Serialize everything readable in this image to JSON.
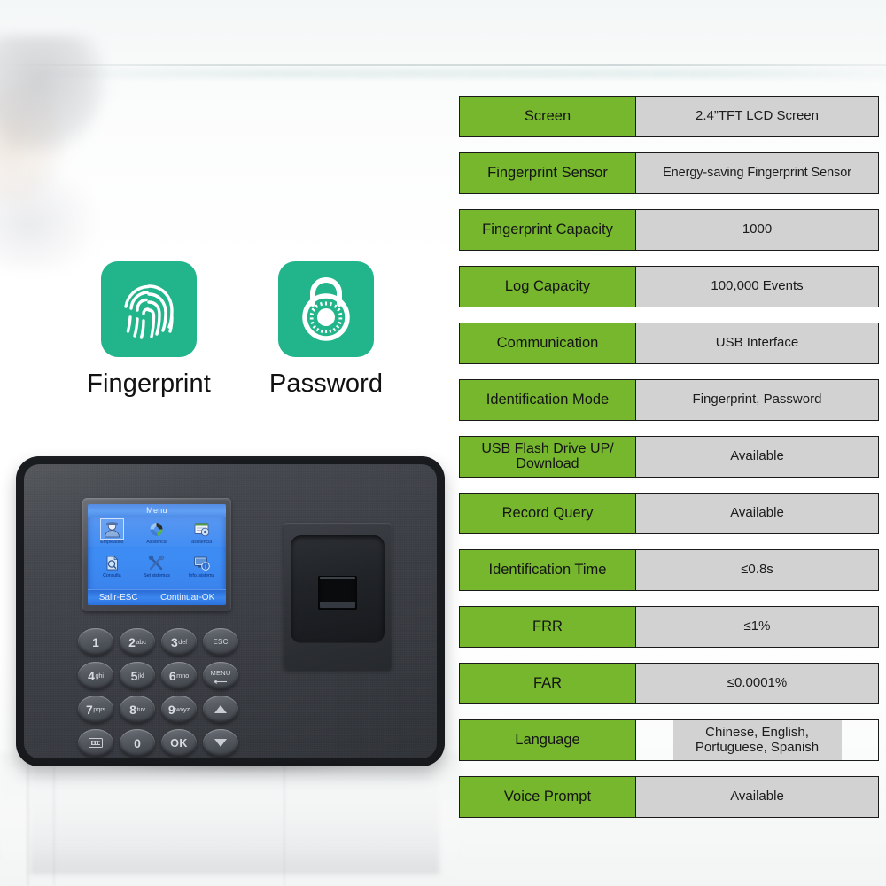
{
  "features": [
    {
      "id": "fingerprint",
      "label": "Fingerprint",
      "icon": "fingerprint-icon",
      "color": "#22b58c"
    },
    {
      "id": "password",
      "label": "Password",
      "icon": "padlock-icon",
      "color": "#22b58c"
    }
  ],
  "device": {
    "screen": {
      "title": "Menu",
      "menu_items": [
        {
          "label": "Empleados",
          "icon": "user-icon",
          "selected": true
        },
        {
          "label": "Asistencia",
          "icon": "attendance-icon",
          "selected": false
        },
        {
          "label": "asistencia",
          "icon": "records-icon",
          "selected": false
        },
        {
          "label": "Consulta",
          "icon": "query-icon",
          "selected": false
        },
        {
          "label": "Set sistemas",
          "icon": "tools-icon",
          "selected": false
        },
        {
          "label": "Info. sistema",
          "icon": "system-info-icon",
          "selected": false
        }
      ],
      "footer_left": "Salir-ESC",
      "footer_right": "Continuar-OK"
    },
    "keypad": [
      {
        "num": "1",
        "abc": "",
        "type": "digit"
      },
      {
        "num": "2",
        "abc": "abc",
        "type": "digit"
      },
      {
        "num": "3",
        "abc": "def",
        "type": "digit"
      },
      {
        "num": "",
        "abc": "",
        "label": "ESC",
        "type": "esc"
      },
      {
        "num": "4",
        "abc": "ghi",
        "type": "digit"
      },
      {
        "num": "5",
        "abc": "jkl",
        "type": "digit"
      },
      {
        "num": "6",
        "abc": "mno",
        "type": "digit"
      },
      {
        "num": "",
        "abc": "",
        "label": "MENU",
        "type": "menu"
      },
      {
        "num": "7",
        "abc": "pqrs",
        "type": "digit"
      },
      {
        "num": "8",
        "abc": "tuv",
        "type": "digit"
      },
      {
        "num": "9",
        "abc": "wxyz",
        "type": "digit"
      },
      {
        "num": "",
        "abc": "",
        "label": "",
        "type": "up"
      },
      {
        "num": "",
        "abc": "",
        "label": "",
        "type": "keyboard"
      },
      {
        "num": "0",
        "abc": "",
        "type": "digit"
      },
      {
        "num": "",
        "abc": "",
        "label": "OK",
        "type": "ok"
      },
      {
        "num": "",
        "abc": "",
        "label": "",
        "type": "down"
      }
    ],
    "sensor": "fingerprint-sensor"
  },
  "spec_table": {
    "key_color": "#76b72e",
    "value_color": "#d2d2d2",
    "rows": [
      {
        "key": "Screen",
        "value": "2.4”TFT LCD Screen"
      },
      {
        "key": "Fingerprint Sensor",
        "value": "Energy-saving Fingerprint Sensor"
      },
      {
        "key": "Fingerprint Capacity",
        "value": "1000"
      },
      {
        "key": "Log Capacity",
        "value": "100,000 Events"
      },
      {
        "key": "Communication",
        "value": "USB Interface"
      },
      {
        "key": "Identification Mode",
        "value": "Fingerprint, Password"
      },
      {
        "key": "USB Flash Drive UP/ Download",
        "value": "Available"
      },
      {
        "key": "Record Query",
        "value": "Available"
      },
      {
        "key": "Identification Time",
        "value": "≤0.8s"
      },
      {
        "key": "FRR",
        "value": "≤1%"
      },
      {
        "key": "FAR",
        "value": "≤0.0001%"
      },
      {
        "key": "Language",
        "value": "Chinese, English, Portuguese, Spanish"
      },
      {
        "key": "Voice Prompt",
        "value": "Available"
      }
    ]
  }
}
